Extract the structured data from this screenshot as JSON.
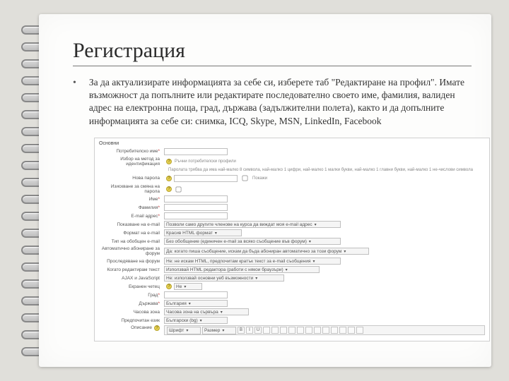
{
  "header": {
    "title": "Регистрация"
  },
  "body": {
    "bullet": "•",
    "text": "За да актуализирате информацията за себе си, изберете таб \"Редактиране на профил\". Имате възможност да попълните или редактирате последователно своето име, фамилия, валиден адрес на електронна поща, град, държава (задължителни полета), както и да допълните информацията за себе си: снимка, ICQ, Skype, MSN, LinkedIn, Facebook"
  },
  "form": {
    "section": "Основни",
    "rows": {
      "username": {
        "label": "Потребителско име",
        "req": "*"
      },
      "pwmethod": {
        "label": "Избор на метод за идентификация",
        "value": "Ръчни потребителски профили",
        "help": "?"
      },
      "pwnote": "Паролата трябва да има най-малко 8 символа, най-малко 1 цифри, най-малко 1 малки букви, най-малко 1 главни букви, най-малко 1 не-числови символа",
      "newpw": {
        "label": "Нова парола",
        "help": "?",
        "cbLabel": "Покажи"
      },
      "force": {
        "label": "Изискване за смяна на парола",
        "help": "?"
      },
      "first": {
        "label": "Име",
        "req": "*"
      },
      "last": {
        "label": "Фамилия",
        "req": "*"
      },
      "email": {
        "label": "E-mail адрес",
        "req": "*"
      },
      "emaildisp": {
        "label": "Показване на e-mail",
        "value": "Позволи само другите членове на курса да виждат моя e-mail адрес"
      },
      "emailfmt": {
        "label": "Формат на e-mail",
        "value": "Красив HTML формат"
      },
      "digest": {
        "label": "Тип на обобщен e-mail",
        "value": "Без обобщение (единичен e-mail за всяко съобщение във форум)"
      },
      "subscribe": {
        "label": "Автоматично абониране за форум",
        "value": "Да: когато пиша съобщение, искам да бъда абониран автоматично за този форум"
      },
      "track": {
        "label": "Проследяване на форум",
        "value": "Не: не искам HTML, предпочитам кратък текст за e-mail съобщения"
      },
      "editor": {
        "label": "Когато редактирам текст",
        "value": "Използвай HTML редактора (работи с някои браузъри)"
      },
      "ajax": {
        "label": "AJAX и JavaScript",
        "value": "Не: използвай основни уеб възможности"
      },
      "reader": {
        "label": "Екранен четец",
        "value": "Не",
        "help": "?"
      },
      "city": {
        "label": "Град",
        "req": "*"
      },
      "country": {
        "label": "Държава",
        "req": "*",
        "value": "България"
      },
      "tz": {
        "label": "Часова зона",
        "value": "Часова зона на сървъра"
      },
      "lang": {
        "label": "Предпочитан език",
        "value": "Български (bg)"
      },
      "descLabel": "Описание",
      "toolbar": {
        "font": "Шрифт",
        "size": "Размер",
        "g1": [
          "B",
          "I",
          "U"
        ],
        "g2": [
          "",
          "",
          "",
          "",
          "",
          "",
          "",
          "",
          "",
          "",
          ""
        ]
      }
    }
  }
}
